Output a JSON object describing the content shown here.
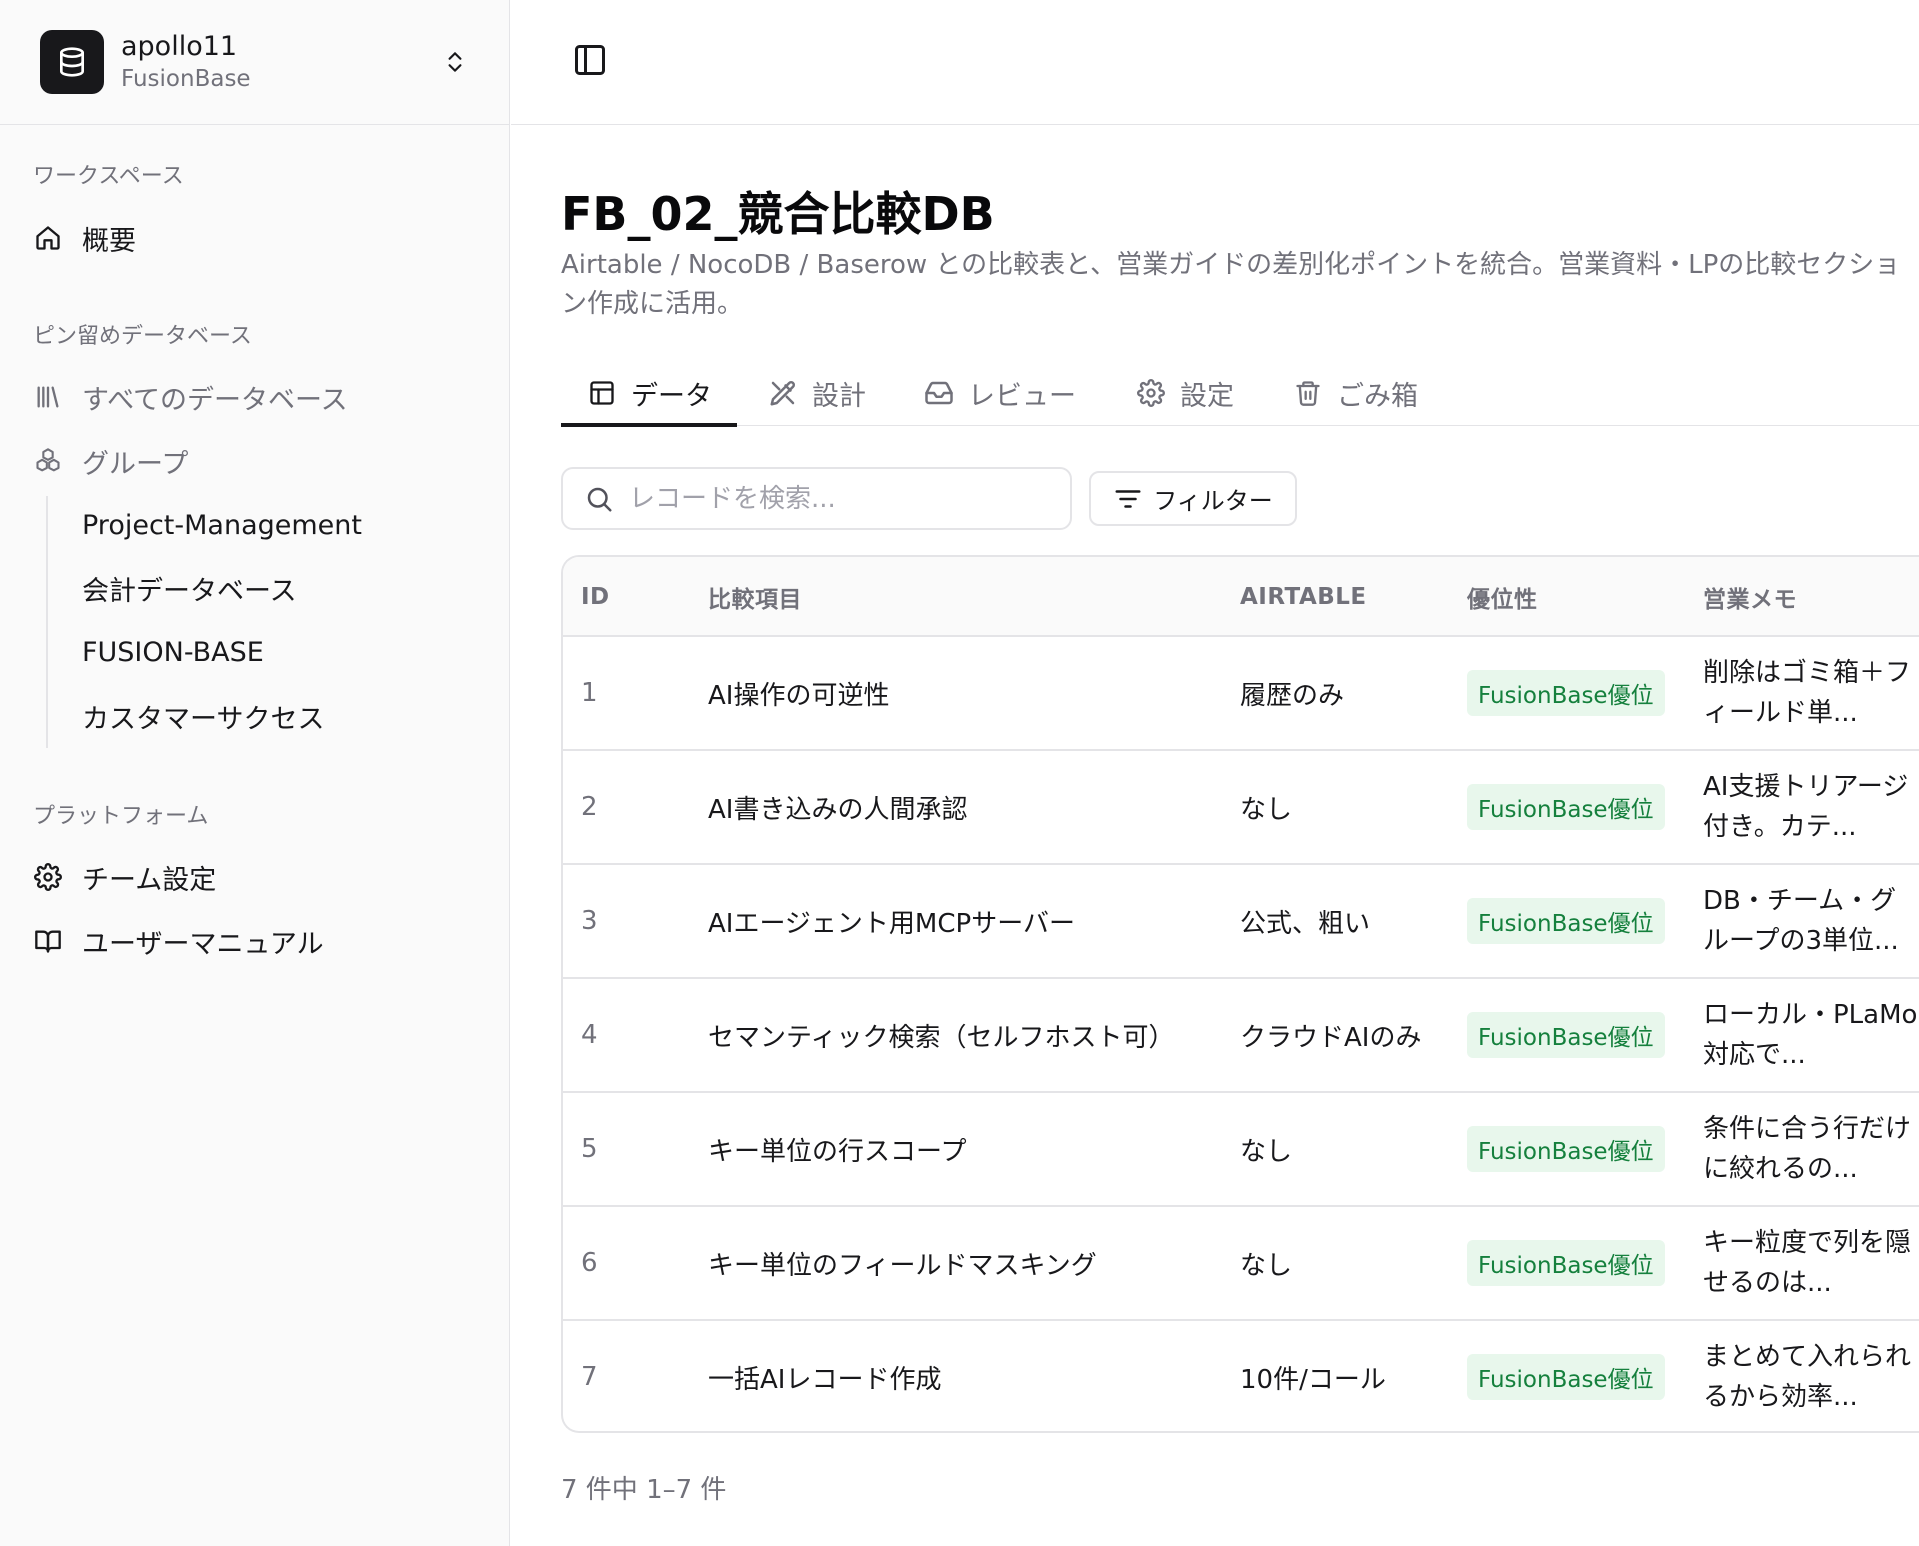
{
  "team": {
    "name": "apollo11",
    "subtitle": "FusionBase"
  },
  "sidebar": {
    "workspace_label": "ワークスペース",
    "overview": "概要",
    "pinned_label": "ピン留めデータベース",
    "all_databases": "すべてのデータベース",
    "group": "グループ",
    "group_items": [
      "Project-Management",
      "会計データベース",
      "FUSION-BASE",
      "カスタマーサクセス"
    ],
    "platform_label": "プラットフォーム",
    "team_settings": "チーム設定",
    "user_manual": "ユーザーマニュアル"
  },
  "page": {
    "title": "FB_02_競合比較DB",
    "description": "Airtable / NocoDB / Baserow との比較表と、営業ガイドの差別化ポイントを統合。営業資料・LPの比較セクション作成に活用。"
  },
  "tabs": [
    {
      "label": "データ",
      "icon": "table-icon",
      "active": true
    },
    {
      "label": "設計",
      "icon": "design-icon",
      "active": false
    },
    {
      "label": "レビュー",
      "icon": "inbox-icon",
      "active": false
    },
    {
      "label": "設定",
      "icon": "gear-icon",
      "active": false
    },
    {
      "label": "ごみ箱",
      "icon": "trash-icon",
      "active": false
    }
  ],
  "search": {
    "placeholder": "レコードを検索..."
  },
  "filter": {
    "label": "フィルター"
  },
  "table": {
    "columns": [
      "ID",
      "比較項目",
      "AIRTABLE",
      "優位性",
      "営業メモ"
    ],
    "rows": [
      {
        "id": "1",
        "item": "AI操作の可逆性",
        "airtable": "履歴のみ",
        "advantage": "FusionBase優位",
        "memo": "削除はゴミ箱＋フィールド単..."
      },
      {
        "id": "2",
        "item": "AI書き込みの人間承認",
        "airtable": "なし",
        "advantage": "FusionBase優位",
        "memo": "AI支援トリアージ付き。カテ..."
      },
      {
        "id": "3",
        "item": "AIエージェント用MCPサーバー",
        "airtable": "公式、粗い",
        "advantage": "FusionBase優位",
        "memo": "DB・チーム・グループの3単位..."
      },
      {
        "id": "4",
        "item": "セマンティック検索（セルフホスト可）",
        "airtable": "クラウドAIのみ",
        "advantage": "FusionBase優位",
        "memo": "ローカル・PLaMo対応で..."
      },
      {
        "id": "5",
        "item": "キー単位の行スコープ",
        "airtable": "なし",
        "advantage": "FusionBase優位",
        "memo": "条件に合う行だけに絞れるの..."
      },
      {
        "id": "6",
        "item": "キー単位のフィールドマスキング",
        "airtable": "なし",
        "advantage": "FusionBase優位",
        "memo": "キー粒度で列を隠せるのは..."
      },
      {
        "id": "7",
        "item": "一括AIレコード作成",
        "airtable": "10件/コール",
        "advantage": "FusionBase優位",
        "memo": "まとめて入れられるから効率..."
      }
    ]
  },
  "pagination": {
    "text": "7 件中 1–7 件"
  }
}
